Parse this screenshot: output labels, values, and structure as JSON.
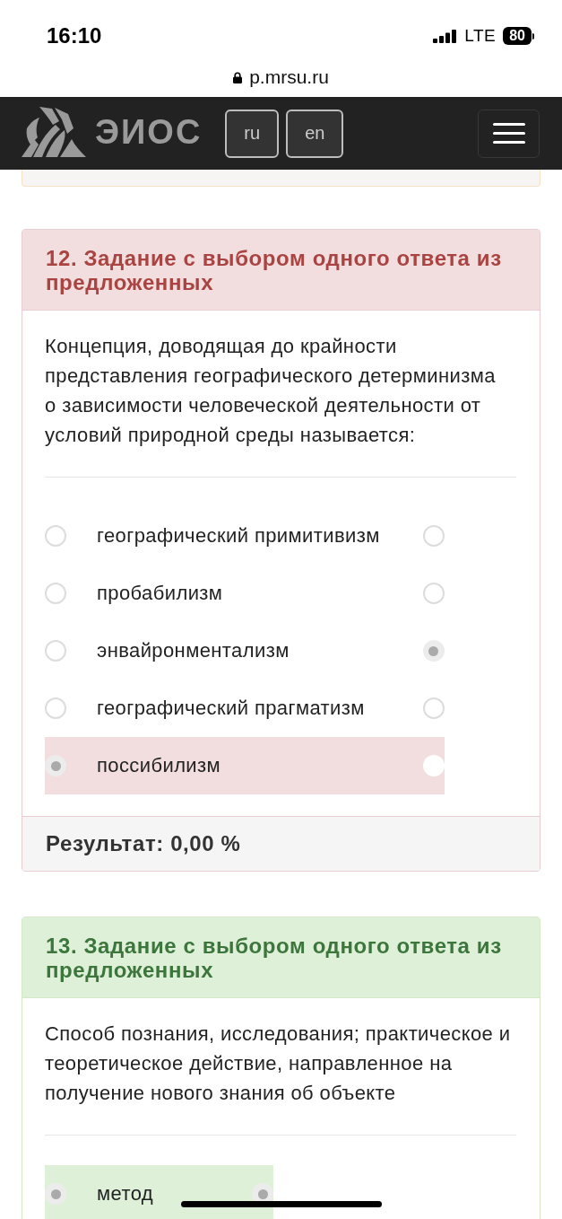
{
  "status_bar": {
    "time": "16:10",
    "network": "LTE",
    "battery": "80"
  },
  "address_bar": {
    "url": "p.mrsu.ru"
  },
  "navbar": {
    "logo_text": "ЭИОС",
    "languages": [
      {
        "label": "ru"
      },
      {
        "label": "en"
      }
    ]
  },
  "previous_task_edge": {
    "kind": "warning"
  },
  "tasks": [
    {
      "title": "12. Задание с выбором одного ответа из предложенных",
      "kind": "incorrect",
      "question": "Концепция, доводящая до крайности представления географического детерминизма о зависимости человеческой деятельности от условий природной среды называется:",
      "options": [
        {
          "label": "географический примитивизм",
          "selected": false,
          "correct": false
        },
        {
          "label": "пробабилизм",
          "selected": false,
          "correct": false
        },
        {
          "label": "энвайронментализм",
          "selected": false,
          "correct": true
        },
        {
          "label": "географический прагматизм",
          "selected": false,
          "correct": false
        },
        {
          "label": "поссибилизм",
          "selected": true,
          "correct": false
        }
      ],
      "result": "Результат: 0,00 %"
    },
    {
      "title": "13. Задание с выбором одного ответа из предложенных",
      "kind": "correct",
      "question": "Способ познания, исследования; практическое и теоретическое действие, направленное на получение нового знания об объекте",
      "options": [
        {
          "label": "метод",
          "selected": true,
          "correct": true
        }
      ]
    }
  ]
}
